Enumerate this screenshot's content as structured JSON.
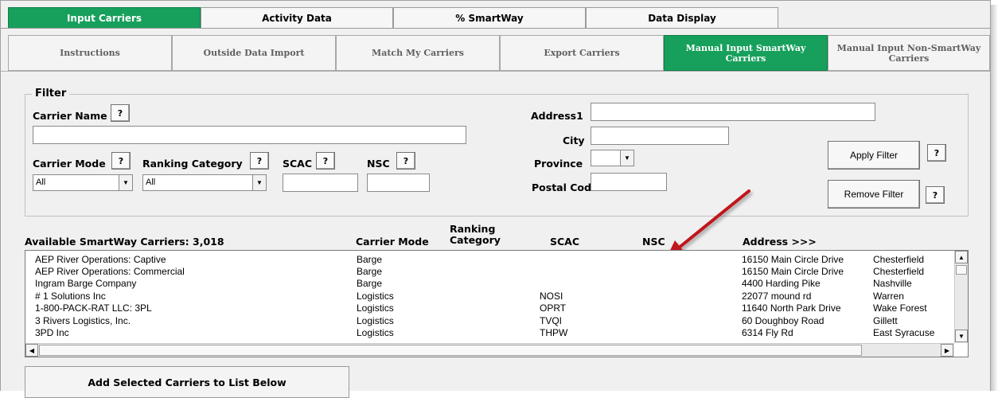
{
  "main_tabs": [
    {
      "label": "Input Carriers"
    },
    {
      "label": "Activity Data"
    },
    {
      "label": "% SmartWay"
    },
    {
      "label": "Data Display"
    }
  ],
  "sub_tabs": [
    {
      "label": "Instructions"
    },
    {
      "label": "Outside Data Import"
    },
    {
      "label": "Match My Carriers"
    },
    {
      "label": "Export Carriers"
    },
    {
      "label": "Manual Input SmartWay Carriers"
    },
    {
      "label": "Manual Input Non-SmartWay Carriers"
    }
  ],
  "filter": {
    "title": "Filter",
    "help": "?",
    "carrier_name_label": "Carrier Name",
    "carrier_name_value": "",
    "carrier_mode_label": "Carrier Mode",
    "carrier_mode_value": "All",
    "ranking_category_label": "Ranking Category",
    "ranking_category_value": "All",
    "scac_label": "SCAC",
    "scac_value": "",
    "nsc_label": "NSC",
    "nsc_value": "",
    "address1_label": "Address1",
    "address1_value": "",
    "city_label": "City",
    "city_value": "",
    "province_label": "Province",
    "province_value": "",
    "postal_code_label": "Postal Code",
    "postal_code_value": "",
    "apply_label": "Apply Filter",
    "remove_label": "Remove Filter"
  },
  "list": {
    "available_label": "Available SmartWay Carriers: 3,018",
    "col_mode": "Carrier Mode",
    "col_ranking": "Ranking Category",
    "col_scac": "SCAC",
    "col_nsc": "NSC",
    "col_address": "Address >>>",
    "rows": [
      {
        "name": "AEP River Operations: Captive",
        "mode": "Barge",
        "scac": "",
        "address": "16150 Main Circle Drive",
        "city": "Chesterfield"
      },
      {
        "name": "AEP River Operations: Commercial",
        "mode": "Barge",
        "scac": "",
        "address": "16150 Main Circle Drive",
        "city": "Chesterfield"
      },
      {
        "name": "Ingram Barge Company",
        "mode": "Barge",
        "scac": "",
        "address": "4400 Harding Pike",
        "city": "Nashville"
      },
      {
        "name": "# 1 Solutions Inc",
        "mode": "Logistics",
        "scac": "NOSI",
        "address": "22077 mound rd",
        "city": "Warren"
      },
      {
        "name": "1-800-PACK-RAT LLC: 3PL",
        "mode": "Logistics",
        "scac": "OPRT",
        "address": "11640 North Park Drive",
        "city": "Wake Forest"
      },
      {
        "name": "3 Rivers Logistics, Inc.",
        "mode": "Logistics",
        "scac": "TVQI",
        "address": "60 Doughboy Road",
        "city": "Gillett"
      },
      {
        "name": "3PD Inc",
        "mode": "Logistics",
        "scac": "THPW",
        "address": "6314 Fly Rd",
        "city": "East Syracuse"
      }
    ]
  },
  "add_button_label": "Add Selected Carriers to List Below",
  "colors": {
    "active_tab": "#17a05c",
    "annotation_arrow": "#c0141c"
  }
}
